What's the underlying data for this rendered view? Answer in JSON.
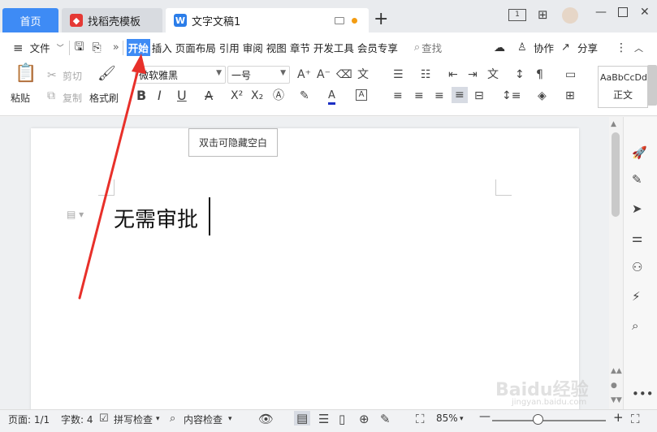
{
  "tabs": {
    "home": "首页",
    "template": "找稻壳模板",
    "doc": "文字文稿1",
    "close": "✕",
    "add": "+"
  },
  "menu": {
    "file": "文件",
    "items": [
      "开始",
      "插入",
      "页面布局",
      "引用",
      "审阅",
      "视图",
      "章节",
      "开发工具",
      "会员专享"
    ],
    "search": "查找",
    "collab": "协作",
    "share": "分享"
  },
  "ribbon": {
    "paste": "粘贴",
    "cut": "剪切",
    "copy": "复制",
    "format_painter": "格式刷",
    "font_name": "微软雅黑",
    "font_size": "一号",
    "style_preview": "AaBbCcDd",
    "style_name": "正文"
  },
  "document": {
    "tooltip": "双击可隐藏空白",
    "content": "无需审批"
  },
  "status": {
    "page": "页面: 1/1",
    "words": "字数: 4",
    "spell": "拼写检查",
    "content_check": "内容检查",
    "zoom": "85%",
    "zoom_value": 85
  },
  "watermark": {
    "text": "Baidu经验",
    "sub": "jingyan.baidu.com"
  },
  "colors": {
    "accent": "#3e8bf5",
    "arrow": "#e8302a"
  }
}
